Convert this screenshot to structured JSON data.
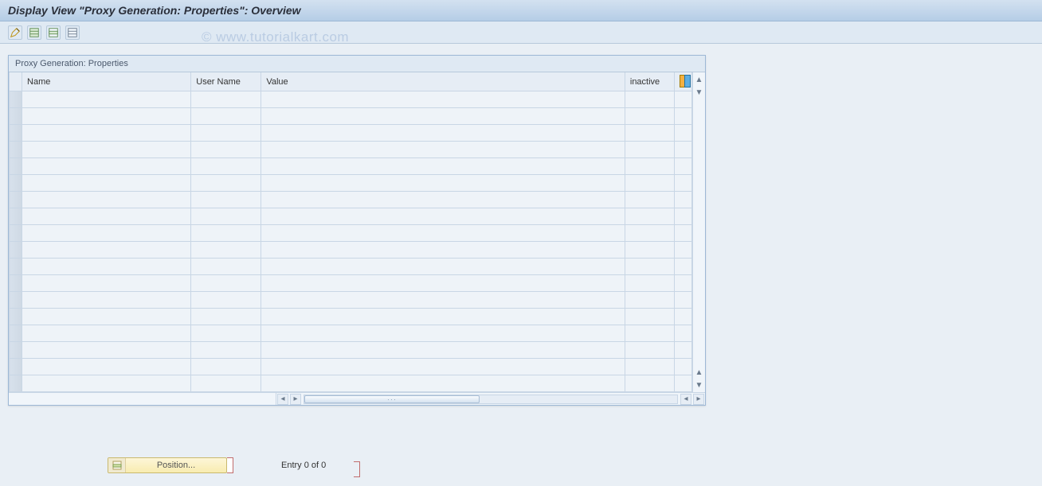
{
  "header": {
    "title": "Display View \"Proxy Generation: Properties\": Overview"
  },
  "toolbar": {
    "buttons": [
      {
        "name": "toggle-display-change-button",
        "icon": "pencil-toggle-icon"
      },
      {
        "name": "select-all-button",
        "icon": "select-all-icon"
      },
      {
        "name": "select-block-button",
        "icon": "select-block-icon"
      },
      {
        "name": "deselect-all-button",
        "icon": "deselect-all-icon"
      }
    ]
  },
  "watermark": "© www.tutorialkart.com",
  "panel": {
    "title": "Proxy Generation: Properties",
    "columns": {
      "name": "Name",
      "user_name": "User Name",
      "value": "Value",
      "inactive": "inactive"
    },
    "rows": [
      {
        "name": "",
        "user_name": "",
        "value": "",
        "inactive": ""
      },
      {
        "name": "",
        "user_name": "",
        "value": "",
        "inactive": ""
      },
      {
        "name": "",
        "user_name": "",
        "value": "",
        "inactive": ""
      },
      {
        "name": "",
        "user_name": "",
        "value": "",
        "inactive": ""
      },
      {
        "name": "",
        "user_name": "",
        "value": "",
        "inactive": ""
      },
      {
        "name": "",
        "user_name": "",
        "value": "",
        "inactive": ""
      },
      {
        "name": "",
        "user_name": "",
        "value": "",
        "inactive": ""
      },
      {
        "name": "",
        "user_name": "",
        "value": "",
        "inactive": ""
      },
      {
        "name": "",
        "user_name": "",
        "value": "",
        "inactive": ""
      },
      {
        "name": "",
        "user_name": "",
        "value": "",
        "inactive": ""
      },
      {
        "name": "",
        "user_name": "",
        "value": "",
        "inactive": ""
      },
      {
        "name": "",
        "user_name": "",
        "value": "",
        "inactive": ""
      },
      {
        "name": "",
        "user_name": "",
        "value": "",
        "inactive": ""
      },
      {
        "name": "",
        "user_name": "",
        "value": "",
        "inactive": ""
      },
      {
        "name": "",
        "user_name": "",
        "value": "",
        "inactive": ""
      },
      {
        "name": "",
        "user_name": "",
        "value": "",
        "inactive": ""
      },
      {
        "name": "",
        "user_name": "",
        "value": "",
        "inactive": ""
      },
      {
        "name": "",
        "user_name": "",
        "value": "",
        "inactive": ""
      }
    ]
  },
  "footer": {
    "position_label": "Position...",
    "entry_status": "Entry 0 of 0"
  }
}
